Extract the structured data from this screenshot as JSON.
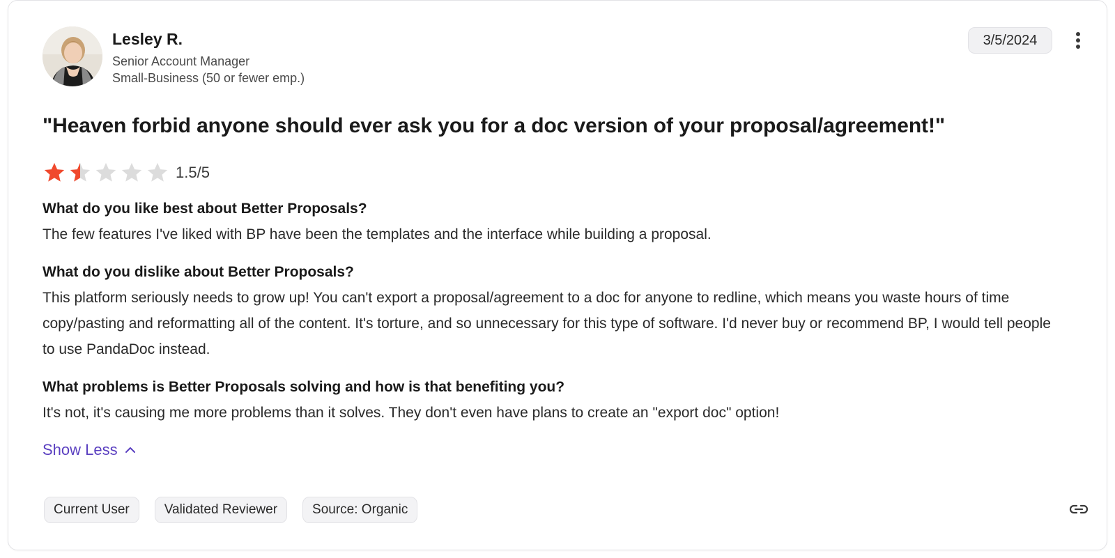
{
  "reviewer": {
    "name": "Lesley R.",
    "title": "Senior Account Manager",
    "company_size": "Small-Business (50 or fewer emp.)",
    "avatar_icon": "person-photo"
  },
  "review": {
    "date": "3/5/2024",
    "title": "\"Heaven forbid anyone should ever ask you for a doc version of your proposal/agreement!\"",
    "rating": 1.5,
    "rating_max": 5,
    "rating_text": "1.5/5",
    "star_color": "#f0492d",
    "star_empty_color": "#dcdcdc",
    "qa": [
      {
        "question": "What do you like best about Better Proposals?",
        "answer": "The few features I've liked with BP have been the templates and the interface while building a proposal."
      },
      {
        "question": "What do you dislike about Better Proposals?",
        "answer": "This platform seriously needs to grow up! You can't export a proposal/agreement to a doc for anyone to redline, which means you waste hours of time copy/pasting and reformatting all of the content. It's torture, and so unnecessary for this type of software. I'd never buy or recommend BP, I would tell people to use PandaDoc instead."
      },
      {
        "question": "What problems is Better Proposals solving and how is that benefiting you?",
        "answer": "It's not, it's causing me more problems than it solves. They don't even have plans to create an \"export doc\" option!"
      }
    ]
  },
  "controls": {
    "show_less_label": "Show Less",
    "more_icon": "more-vertical-icon",
    "link_icon": "link-icon",
    "accent_color": "#5a3fc0"
  },
  "tags": [
    "Current User",
    "Validated Reviewer",
    "Source: Organic"
  ]
}
